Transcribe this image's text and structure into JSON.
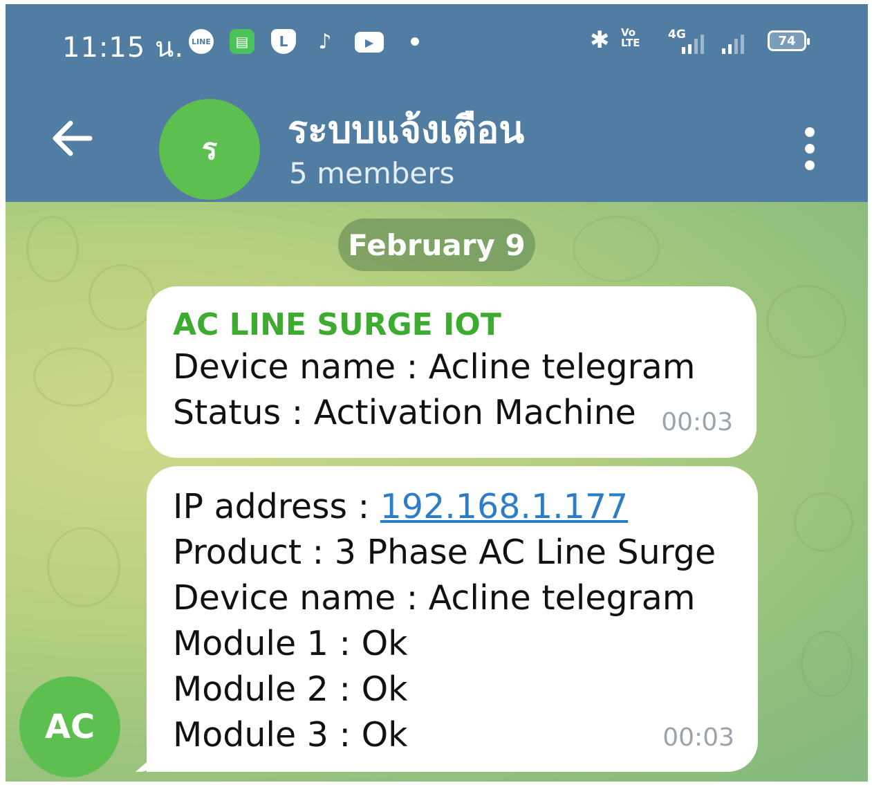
{
  "status_bar": {
    "time": "11:15 น.",
    "notification_icons": [
      "line-icon",
      "messages-icon",
      "line-l-icon",
      "tiktok-icon",
      "youtube-icon"
    ],
    "volte": "Vo LTE",
    "network": "4G",
    "battery": "74"
  },
  "header": {
    "avatar_letter": "ร",
    "title": "ระบบแจ้งเตือน",
    "subtitle": "5 members"
  },
  "chat": {
    "date_label": "February 9",
    "messages": [
      {
        "sender": "AC LINE SURGE IOT",
        "lines": [
          "Device name : Acline telegram",
          "Status : Activation Machine"
        ],
        "time": "00:03"
      },
      {
        "ip_prefix": "IP address : ",
        "ip_link": "192.168.1.177",
        "lines": [
          "Product : 3 Phase AC Line Surge",
          "Device name : Acline telegram",
          "Module 1 : Ok",
          "Module 2 : Ok",
          "Module 3 : Ok"
        ],
        "time": "00:03"
      }
    ],
    "sender_avatar": "AC"
  },
  "colors": {
    "header": "#517da2",
    "avatar": "#5dbf4f",
    "sender_name": "#3cab2f",
    "link": "#2b7cc9"
  }
}
